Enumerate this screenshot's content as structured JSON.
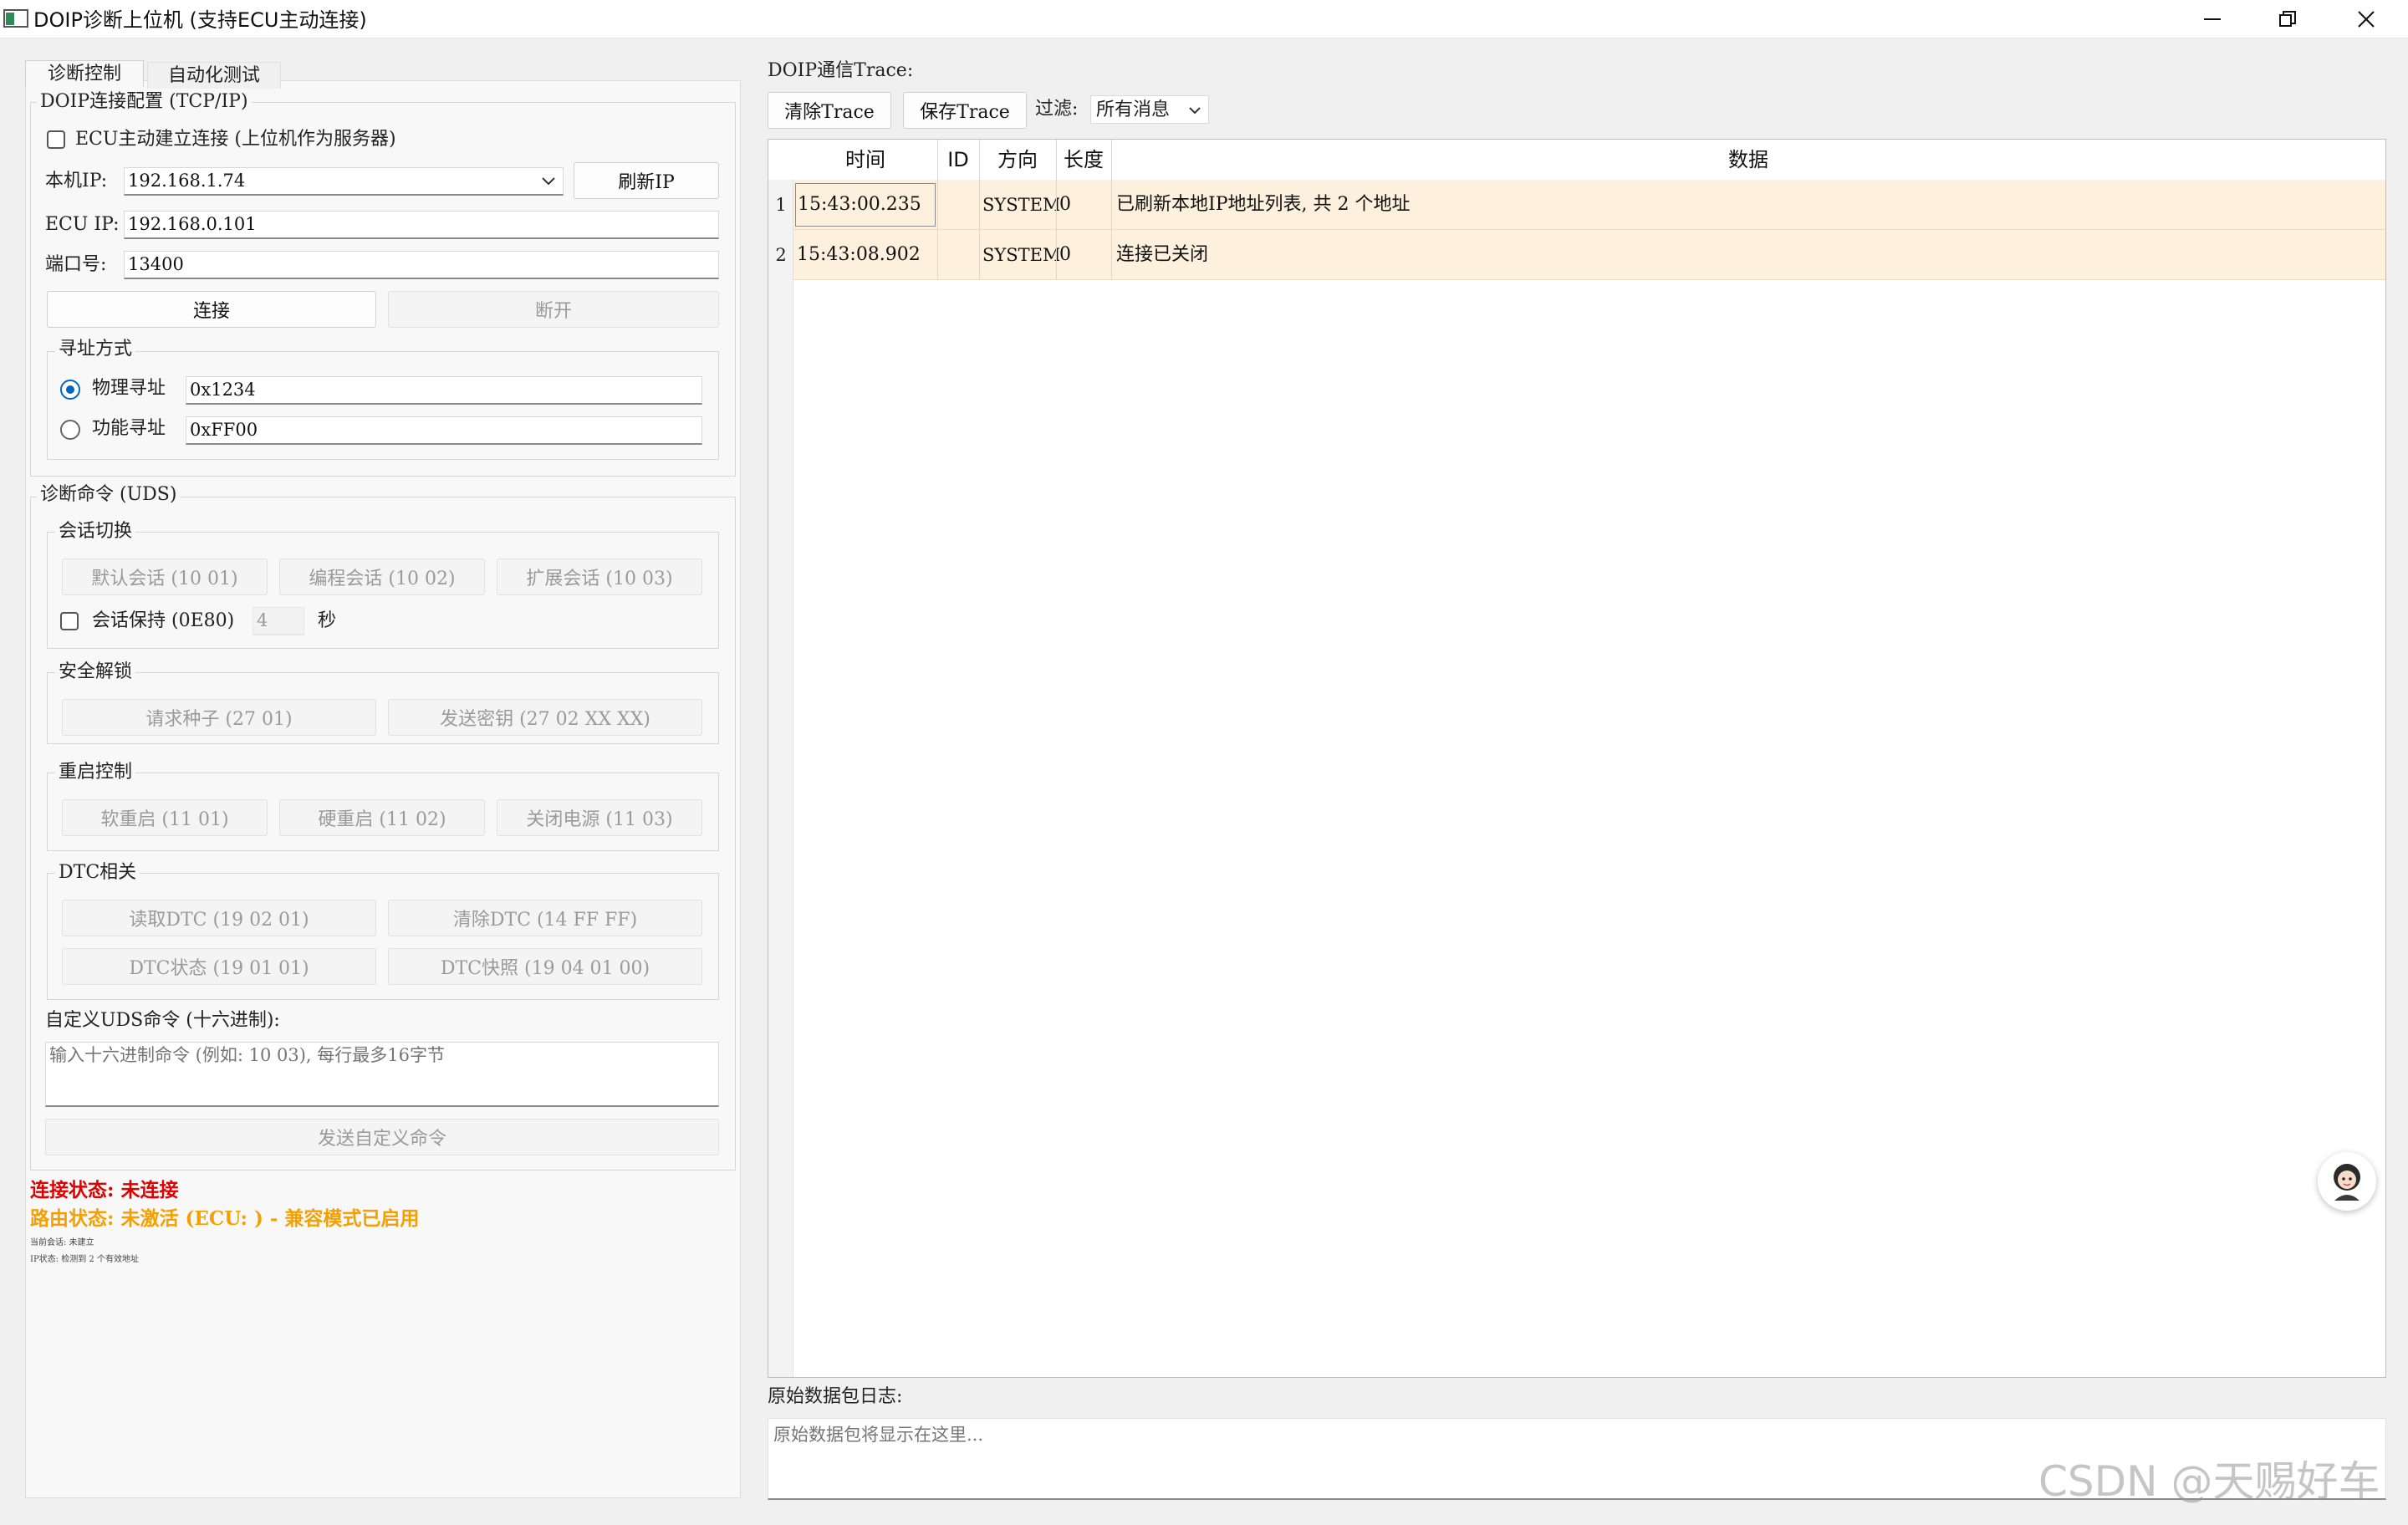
{
  "window": {
    "title": "DOIP诊断上位机 (支持ECU主动连接)"
  },
  "tabs": [
    {
      "label": "诊断控制",
      "active": true
    },
    {
      "label": "自动化测试",
      "active": false
    }
  ],
  "doip_config": {
    "group_title": "DOIP连接配置 (TCP/IP)",
    "ecu_active_label": "ECU主动建立连接 (上位机作为服务器)",
    "ecu_active_checked": false,
    "local_ip_label": "本机IP:",
    "local_ip_value": "192.168.1.74",
    "refresh_ip_button": "刷新IP",
    "ecu_ip_label": "ECU IP:",
    "ecu_ip_value": "192.168.0.101",
    "port_label": "端口号:",
    "port_value": "13400",
    "connect_button": "连接",
    "disconnect_button": "断开",
    "addressing": {
      "title": "寻址方式",
      "physical_label": "物理寻址",
      "physical_value": "0x1234",
      "physical_selected": true,
      "functional_label": "功能寻址",
      "functional_value": "0xFF00",
      "functional_selected": false
    }
  },
  "uds": {
    "group_title": "诊断命令 (UDS)",
    "session": {
      "title": "会话切换",
      "default_button": "默认会话 (10 01)",
      "programming_button": "编程会话 (10 02)",
      "extended_button": "扩展会话 (10 03)",
      "keepalive_label": "会话保持 (0E80)",
      "keepalive_checked": false,
      "keepalive_value": "4",
      "keepalive_unit": "秒"
    },
    "security": {
      "title": "安全解锁",
      "seed_button": "请求种子 (27 01)",
      "key_button": "发送密钥 (27 02 XX XX)"
    },
    "reset": {
      "title": "重启控制",
      "soft_button": "软重启 (11 01)",
      "hard_button": "硬重启 (11 02)",
      "power_button": "关闭电源 (11 03)"
    },
    "dtc": {
      "title": "DTC相关",
      "read_button": "读取DTC (19 02 01)",
      "clear_button": "清除DTC (14 FF FF)",
      "status_button": "DTC状态 (19 01 01)",
      "snapshot_button": "DTC快照 (19 04 01 00)"
    },
    "custom": {
      "label": "自定义UDS命令 (十六进制):",
      "placeholder": "输入十六进制命令 (例如: 10 03), 每行最多16字节",
      "send_button": "发送自定义命令"
    }
  },
  "status": {
    "connection": "连接状态: 未连接",
    "routing": "路由状态: 未激活 (ECU: ) - 兼容模式已启用",
    "session_small": "当前会话: 未建立",
    "ip_small": "IP状态: 检测到 2 个有效地址",
    "connection_color": "#e00000",
    "routing_color": "#f5a000"
  },
  "trace": {
    "title": "DOIP通信Trace:",
    "clear_button": "清除Trace",
    "save_button": "保存Trace",
    "filter_label": "过滤:",
    "filter_value": "所有消息",
    "columns": [
      "时间",
      "ID",
      "方向",
      "长度",
      "数据"
    ],
    "rows": [
      {
        "num": "1",
        "time": "15:43:00.235",
        "id": "",
        "direction": "SYSTEM",
        "length": "0",
        "data": "已刷新本地IP地址列表, 共 2 个地址"
      },
      {
        "num": "2",
        "time": "15:43:08.902",
        "id": "",
        "direction": "SYSTEM",
        "length": "0",
        "data": "连接已关闭"
      }
    ],
    "row_color": "#fdf0dc"
  },
  "raw_log": {
    "title": "原始数据包日志:",
    "placeholder": "原始数据包将显示在这里..."
  },
  "watermark": "CSDN @天赐好车"
}
